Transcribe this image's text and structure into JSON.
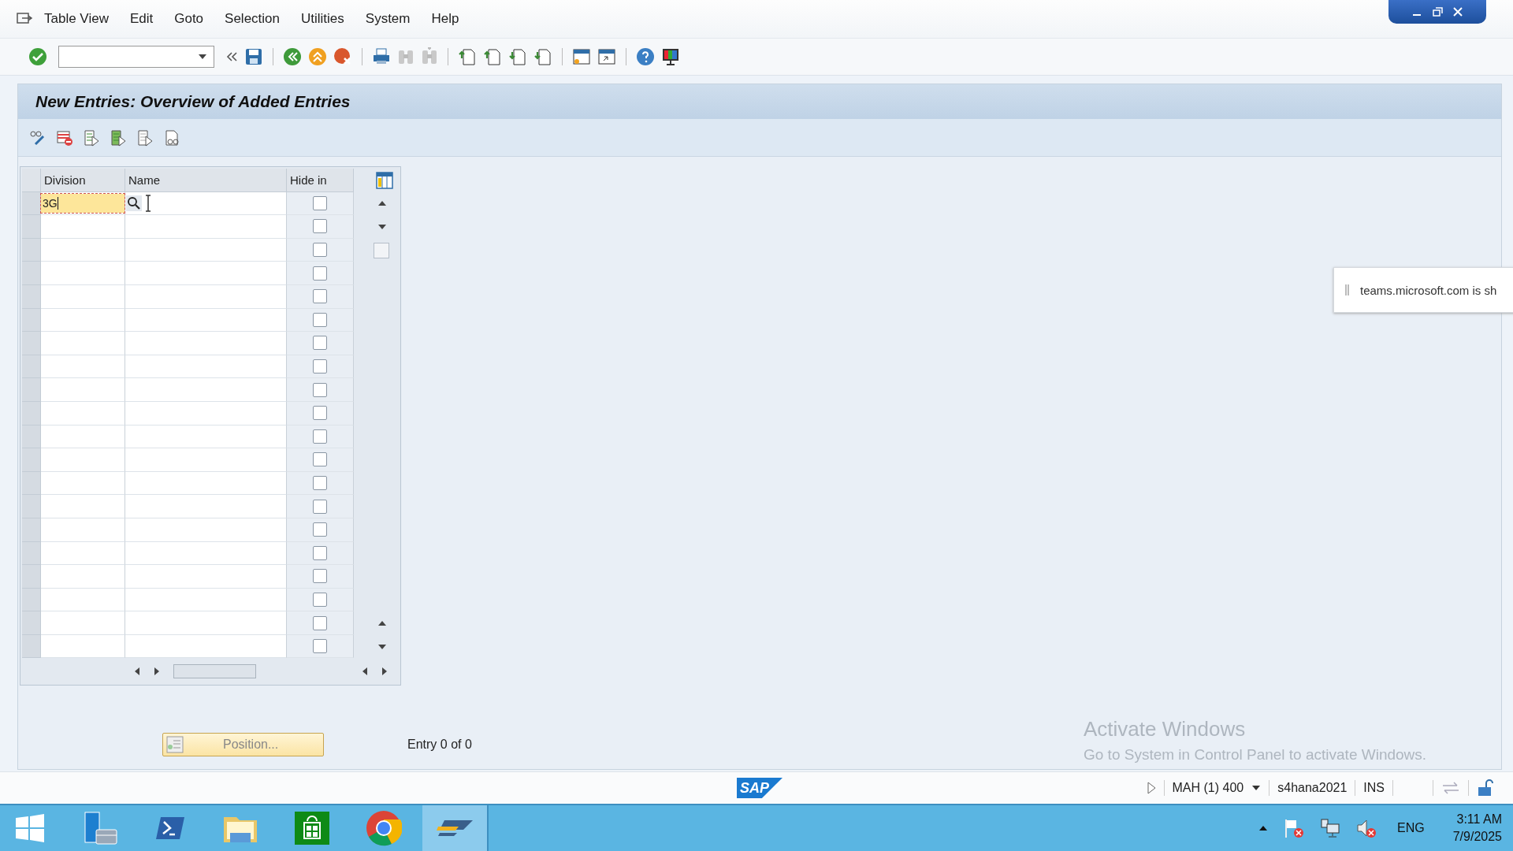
{
  "menu": [
    {
      "label": "Table View"
    },
    {
      "label": "Edit"
    },
    {
      "label": "Goto"
    },
    {
      "label": "Selection"
    },
    {
      "label": "Utilities"
    },
    {
      "label": "System"
    },
    {
      "label": "Help"
    }
  ],
  "title": "New Entries: Overview of Added Entries",
  "table": {
    "columns": [
      "Division",
      "Name",
      "Hide in"
    ],
    "rows": [
      {
        "division": "3G",
        "focused": true,
        "hide_in": false
      },
      {
        "focused": false,
        "hide_in": false
      },
      {
        "focused": false,
        "hide_in": false
      },
      {
        "focused": false,
        "hide_in": false
      },
      {
        "focused": false,
        "hide_in": false
      },
      {
        "focused": false,
        "hide_in": false
      },
      {
        "focused": false,
        "hide_in": false
      },
      {
        "focused": false,
        "hide_in": false
      },
      {
        "focused": false,
        "hide_in": false
      },
      {
        "focused": false,
        "hide_in": false
      },
      {
        "focused": false,
        "hide_in": false
      },
      {
        "focused": false,
        "hide_in": false
      },
      {
        "focused": false,
        "hide_in": false
      },
      {
        "focused": false,
        "hide_in": false
      },
      {
        "focused": false,
        "hide_in": false
      },
      {
        "focused": false,
        "hide_in": false
      },
      {
        "focused": false,
        "hide_in": false
      },
      {
        "focused": false,
        "hide_in": false
      },
      {
        "focused": false,
        "hide_in": false
      },
      {
        "focused": false,
        "hide_in": false
      }
    ]
  },
  "position_button": "Position...",
  "entry_count": "Entry 0 of 0",
  "logo": "SAP",
  "status_bar": {
    "session": "MAH (1) 400",
    "server": "s4hana2021",
    "mode": "INS"
  },
  "notification": "teams.microsoft.com is sh",
  "activation": {
    "title": "Activate Windows",
    "text": "Go to System in Control Panel to activate Windows."
  },
  "taskbar": {
    "language": "ENG",
    "time": "3:11 AM",
    "date": "7/9/2025"
  }
}
